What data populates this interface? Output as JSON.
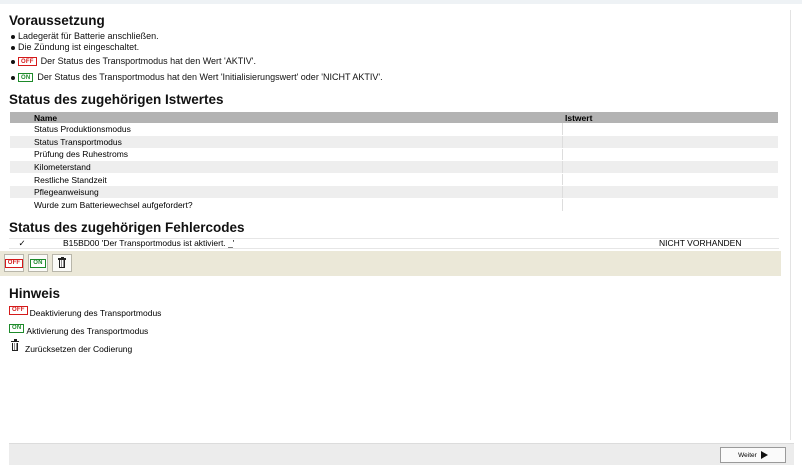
{
  "voraussetzung": {
    "title": "Voraussetzung",
    "items": [
      "Ladegerät für Batterie anschließen.",
      "Die Zündung ist eingeschaltet.",
      "Der Status des Transportmodus hat den Wert 'AKTIV'.",
      "Der Status des Transportmodus hat den Wert 'Initialisierungswert' oder 'NICHT AKTIV'."
    ]
  },
  "badges": {
    "off": "OFF",
    "on": "ON",
    "off_color": "#d41a1a",
    "on_color": "#1d8a2a"
  },
  "istwerte": {
    "title": "Status des zugehörigen Istwertes",
    "columns": [
      "Name",
      "Istwert"
    ],
    "rows": [
      "Status Produktionsmodus",
      "Status Transportmodus",
      "Prüfung des Ruhestroms",
      "Kilometerstand",
      "Restliche Standzeit",
      "Pflegeanweisung",
      "Wurde zum Batteriewechsel aufgefordert?"
    ]
  },
  "fehlercodes": {
    "title": "Status des zugehörigen Fehlercodes",
    "check": "✓",
    "code": "B15BD00 'Der Transportmodus ist aktiviert. _'",
    "state": "NICHT VORHANDEN"
  },
  "hinweis": {
    "title": "Hinweis",
    "items": [
      "Deaktivierung des Transportmodus",
      "Aktivierung des Transportmodus",
      "Zurücksetzen der Codierung"
    ]
  },
  "footer": {
    "next_label": "Weiter"
  },
  "icons": {
    "trash": "trash-icon",
    "check": "checkmark-icon",
    "next": "play-arrow-icon"
  }
}
